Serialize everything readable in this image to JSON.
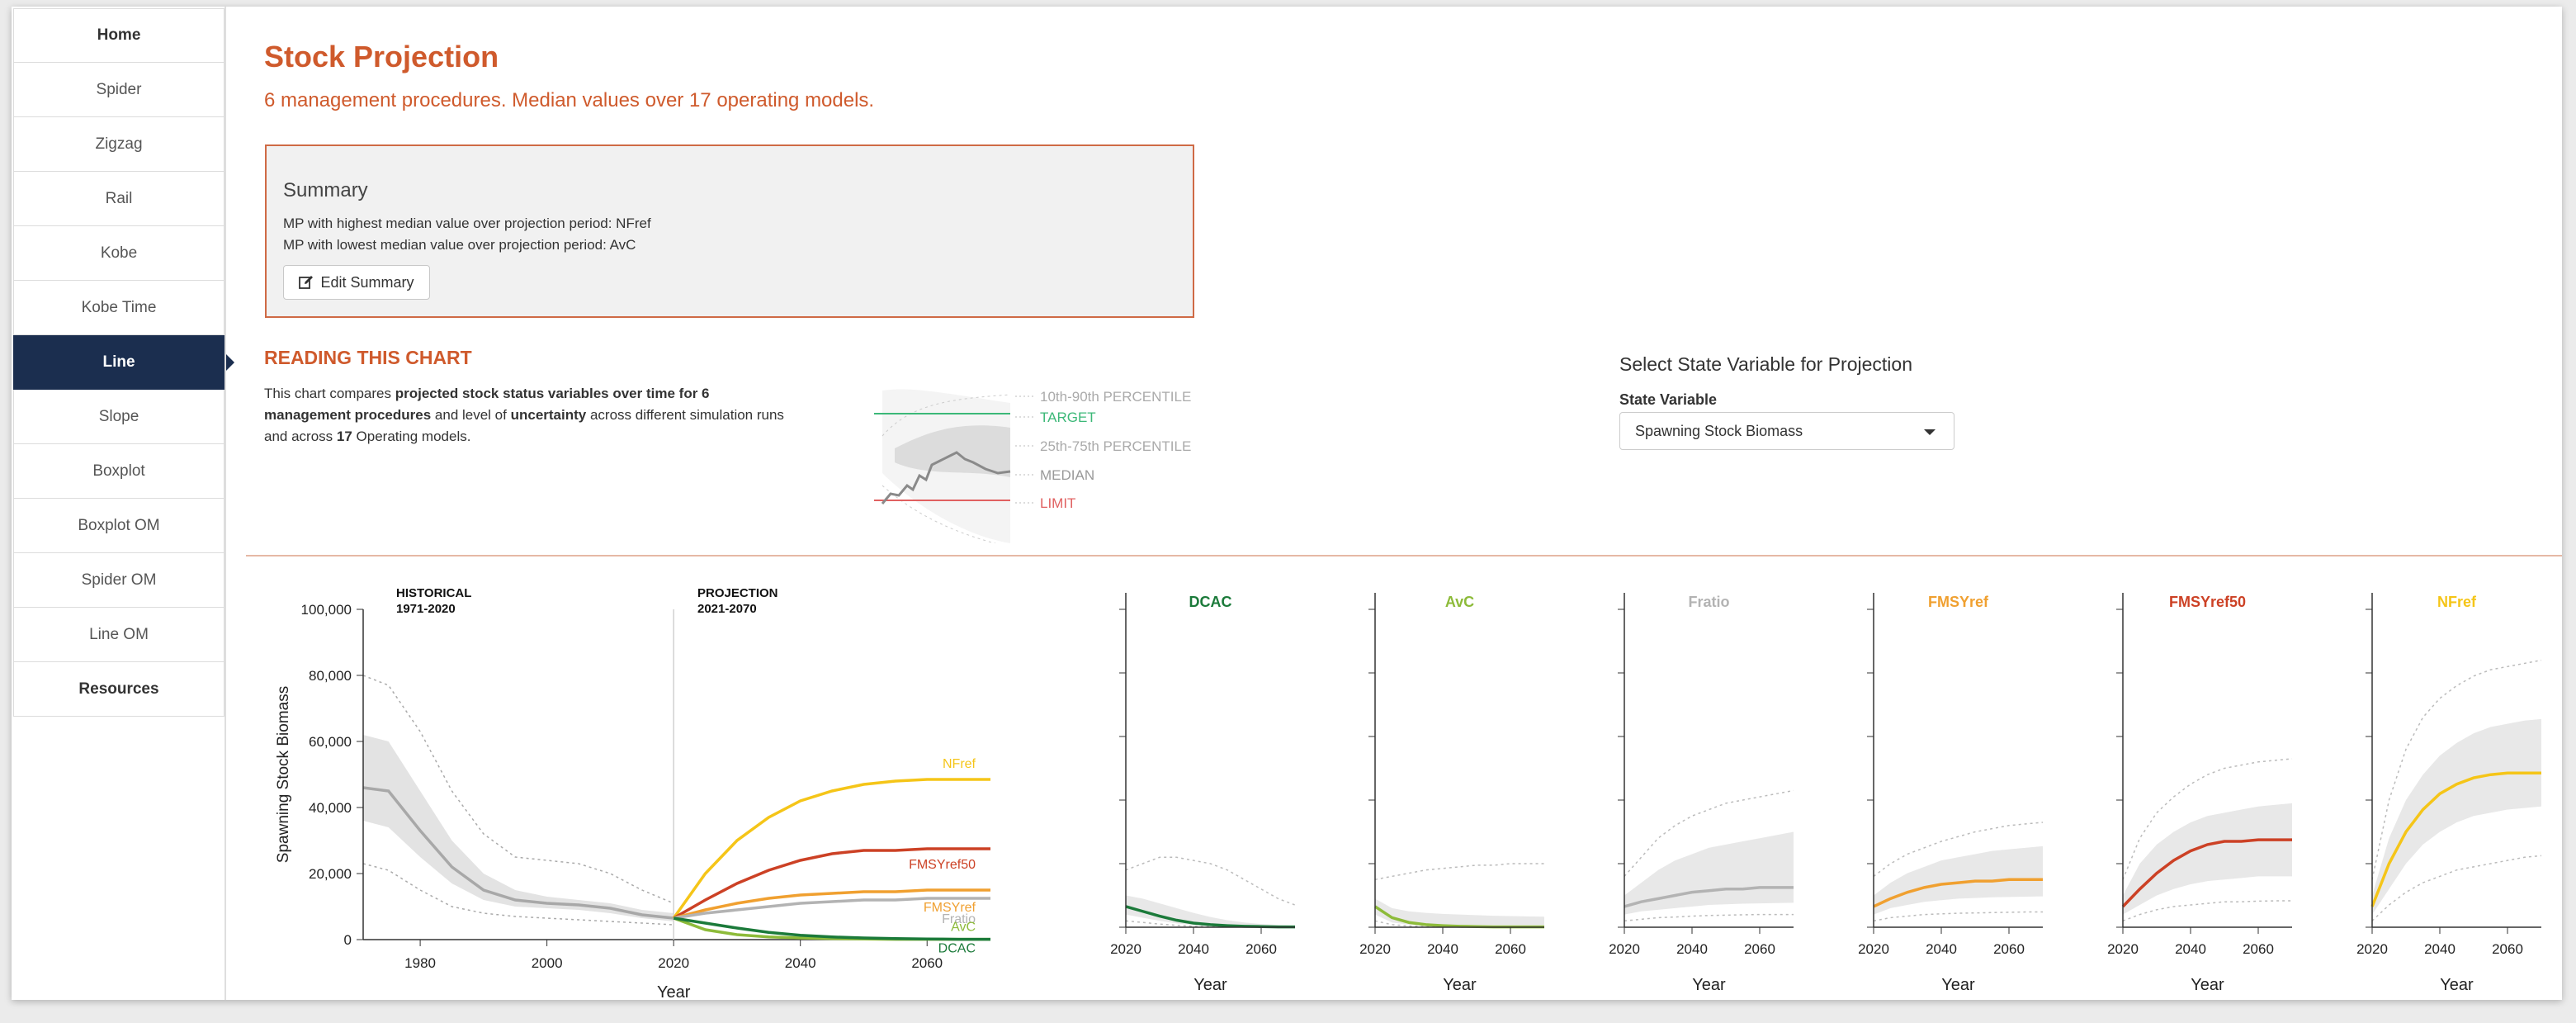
{
  "nav": [
    {
      "label": "Home",
      "bold": true
    },
    {
      "label": "Spider"
    },
    {
      "label": "Zigzag"
    },
    {
      "label": "Rail"
    },
    {
      "label": "Kobe"
    },
    {
      "label": "Kobe Time"
    },
    {
      "label": "Line",
      "active": true
    },
    {
      "label": "Slope"
    },
    {
      "label": "Boxplot"
    },
    {
      "label": "Boxplot OM"
    },
    {
      "label": "Spider OM"
    },
    {
      "label": "Line OM"
    },
    {
      "label": "Resources",
      "bold": true
    }
  ],
  "header": {
    "title": "Stock Projection",
    "subtitle": "6 management procedures. Median values over 17 operating models."
  },
  "summary": {
    "title": "Summary",
    "line1": "MP with highest median value over projection period: NFref",
    "line2": "MP with lowest median value over projection period: AvC",
    "edit_label": "Edit Summary"
  },
  "reading": {
    "title": "READING THIS CHART",
    "p1": "This chart compares ",
    "b1": "projected stock status variables over time for 6 management procedures",
    "p2": " and level of ",
    "b2": "uncertainty",
    "p3": " across different simulation runs and across ",
    "b3": "17",
    "p4": " Operating models."
  },
  "legend": {
    "p90": "10th-90th PERCENTILE",
    "target": "TARGET",
    "p75": "25th-75th PERCENTILE",
    "median": "MEDIAN",
    "limit": "LIMIT"
  },
  "selector": {
    "title": "Select State Variable for Projection",
    "label": "State Variable",
    "value": "Spawning Stock Biomass"
  },
  "colors": {
    "accent": "#cf5a2c",
    "nav_active": "#1b2e4f",
    "DCAC": "#1b7a3a",
    "AvC": "#8dbb3a",
    "Fratio": "#b3b3b3",
    "FMSYref": "#f0a030",
    "FMSYref50": "#cc4125",
    "NFref": "#f5c518"
  },
  "chart_data": [
    {
      "type": "line",
      "ylabel": "Spawning Stock Biomass",
      "xlabel": "Year",
      "ylim": [
        0,
        100000
      ],
      "xlim": [
        1971,
        2070
      ],
      "yticks": [
        0,
        20000,
        40000,
        60000,
        80000,
        100000
      ],
      "ytick_labels": [
        "0",
        "20,000",
        "40,000",
        "60,000",
        "80,000",
        "100,000"
      ],
      "xticks": [
        1980,
        2000,
        2020,
        2040,
        2060
      ],
      "period_labels": [
        {
          "title": "HISTORICAL",
          "range": "1971-2020"
        },
        {
          "title": "PROJECTION",
          "range": "2021-2070"
        }
      ],
      "historical": {
        "x": [
          1971,
          1975,
          1980,
          1985,
          1990,
          1995,
          2000,
          2005,
          2010,
          2015,
          2020
        ],
        "median": [
          46000,
          45000,
          33000,
          22000,
          15000,
          12000,
          11000,
          10500,
          9500,
          7500,
          6500
        ],
        "p25": [
          36000,
          34000,
          25000,
          17000,
          12000,
          10000,
          9500,
          9000,
          8000,
          6500,
          5500
        ],
        "p75": [
          62000,
          60000,
          45000,
          30000,
          20000,
          15000,
          13000,
          12000,
          11000,
          9000,
          8000
        ],
        "p10": [
          23000,
          21000,
          15000,
          10000,
          8000,
          7000,
          6500,
          6000,
          5500,
          5000,
          4500
        ],
        "p90": [
          80000,
          77000,
          63000,
          45000,
          32000,
          25000,
          24000,
          23000,
          20000,
          15000,
          11000
        ]
      },
      "x": [
        2020,
        2025,
        2030,
        2035,
        2040,
        2045,
        2050,
        2055,
        2060,
        2065,
        2070
      ],
      "series": [
        {
          "name": "NFref",
          "values": [
            6500,
            20000,
            30000,
            37000,
            42000,
            45000,
            47000,
            48000,
            48500,
            48500,
            48500
          ]
        },
        {
          "name": "FMSYref50",
          "values": [
            6500,
            12000,
            17000,
            21000,
            24000,
            26000,
            27000,
            27000,
            27500,
            27500,
            27500
          ]
        },
        {
          "name": "FMSYref",
          "values": [
            6500,
            9000,
            11000,
            12500,
            13500,
            14000,
            14500,
            14500,
            15000,
            15000,
            15000
          ]
        },
        {
          "name": "Fratio",
          "values": [
            6500,
            8000,
            9000,
            10000,
            11000,
            11500,
            12000,
            12000,
            12500,
            12500,
            12500
          ]
        },
        {
          "name": "AvC",
          "values": [
            6500,
            3000,
            1500,
            800,
            500,
            300,
            200,
            100,
            100,
            100,
            100
          ]
        },
        {
          "name": "DCAC",
          "values": [
            6500,
            5000,
            3500,
            2200,
            1300,
            800,
            500,
            300,
            200,
            100,
            100
          ]
        }
      ]
    },
    {
      "type": "line",
      "xlabel": "Year",
      "ylim": [
        0,
        100000
      ],
      "xlim": [
        2020,
        2070
      ],
      "xticks": [
        2020,
        2040,
        2060
      ],
      "panels": [
        {
          "name": "DCAC",
          "median": [
            6500,
            5000,
            3500,
            2200,
            1300,
            800,
            500,
            300,
            200,
            100,
            100
          ],
          "p25": [
            4000,
            3000,
            2000,
            1200,
            700,
            400,
            250,
            150,
            100,
            50,
            50
          ],
          "p75": [
            10000,
            9000,
            7500,
            6000,
            4500,
            3200,
            2200,
            1500,
            1000,
            700,
            500
          ],
          "p10": [
            2000,
            1500,
            1000,
            600,
            300,
            200,
            100,
            50,
            50,
            30,
            20
          ],
          "p90": [
            18000,
            20000,
            22000,
            22000,
            21000,
            20000,
            18000,
            15000,
            12000,
            9000,
            7000
          ]
        },
        {
          "name": "AvC",
          "median": [
            6500,
            3000,
            1500,
            800,
            500,
            300,
            200,
            100,
            100,
            100,
            100
          ],
          "p25": [
            4000,
            1500,
            800,
            400,
            250,
            150,
            100,
            50,
            50,
            50,
            50
          ],
          "p75": [
            9000,
            6000,
            5000,
            4500,
            4200,
            4000,
            3800,
            3600,
            3500,
            3400,
            3300
          ],
          "p10": [
            2000,
            800,
            400,
            200,
            100,
            50,
            30,
            20,
            20,
            20,
            20
          ],
          "p90": [
            15000,
            16000,
            17000,
            18000,
            18500,
            19000,
            19500,
            19500,
            20000,
            20000,
            20000
          ]
        },
        {
          "name": "Fratio",
          "median": [
            6500,
            8000,
            9000,
            10000,
            11000,
            11500,
            12000,
            12000,
            12500,
            12500,
            12500
          ],
          "p25": [
            4000,
            5000,
            5500,
            6000,
            6500,
            7000,
            7200,
            7400,
            7500,
            7600,
            7700
          ],
          "p75": [
            10000,
            14000,
            18000,
            21000,
            23000,
            25000,
            26000,
            27000,
            28000,
            29000,
            30000
          ],
          "p10": [
            2000,
            2500,
            3000,
            3200,
            3500,
            3700,
            3800,
            3900,
            4000,
            4000,
            4000
          ],
          "p90": [
            16000,
            22000,
            28000,
            32000,
            35000,
            37000,
            39000,
            40000,
            41000,
            42000,
            43000
          ]
        },
        {
          "name": "FMSYref",
          "median": [
            6500,
            9000,
            11000,
            12500,
            13500,
            14000,
            14500,
            14500,
            15000,
            15000,
            15000
          ],
          "p25": [
            4000,
            6000,
            7000,
            8000,
            8500,
            9000,
            9200,
            9400,
            9500,
            9600,
            9700
          ],
          "p75": [
            10000,
            14000,
            17000,
            19000,
            21000,
            22000,
            23000,
            24000,
            24500,
            25000,
            25500
          ],
          "p10": [
            2000,
            3000,
            3500,
            4000,
            4200,
            4400,
            4500,
            4600,
            4700,
            4800,
            4800
          ],
          "p90": [
            16000,
            20000,
            23000,
            25000,
            27000,
            28500,
            30000,
            31000,
            32000,
            32500,
            33000
          ]
        },
        {
          "name": "FMSYref50",
          "median": [
            6500,
            12000,
            17000,
            21000,
            24000,
            26000,
            27000,
            27000,
            27500,
            27500,
            27500
          ],
          "p25": [
            4000,
            7000,
            10000,
            12000,
            13500,
            14500,
            15000,
            15500,
            16000,
            16000,
            16000
          ],
          "p75": [
            10000,
            20000,
            26000,
            30000,
            33000,
            35000,
            36000,
            37000,
            38000,
            38500,
            39000
          ],
          "p10": [
            2000,
            4000,
            5500,
            6500,
            7000,
            7500,
            8000,
            8000,
            8200,
            8300,
            8300
          ],
          "p90": [
            15000,
            28000,
            36000,
            41000,
            45000,
            48000,
            50000,
            51000,
            52000,
            52500,
            53000
          ]
        },
        {
          "name": "NFref",
          "median": [
            6500,
            20000,
            30000,
            37000,
            42000,
            45000,
            47000,
            48000,
            48500,
            48500,
            48500
          ],
          "p25": [
            4000,
            12000,
            20000,
            26000,
            30000,
            33000,
            35000,
            36000,
            37000,
            37500,
            38000
          ],
          "p75": [
            10000,
            28000,
            40000,
            48000,
            54000,
            58000,
            61000,
            63000,
            64000,
            65000,
            65500
          ],
          "p10": [
            2000,
            7000,
            11000,
            14000,
            16000,
            18000,
            19000,
            20000,
            21000,
            22000,
            22500
          ],
          "p90": [
            15000,
            40000,
            56000,
            66000,
            72000,
            76000,
            79000,
            81000,
            82000,
            83000,
            84000
          ]
        }
      ]
    }
  ]
}
